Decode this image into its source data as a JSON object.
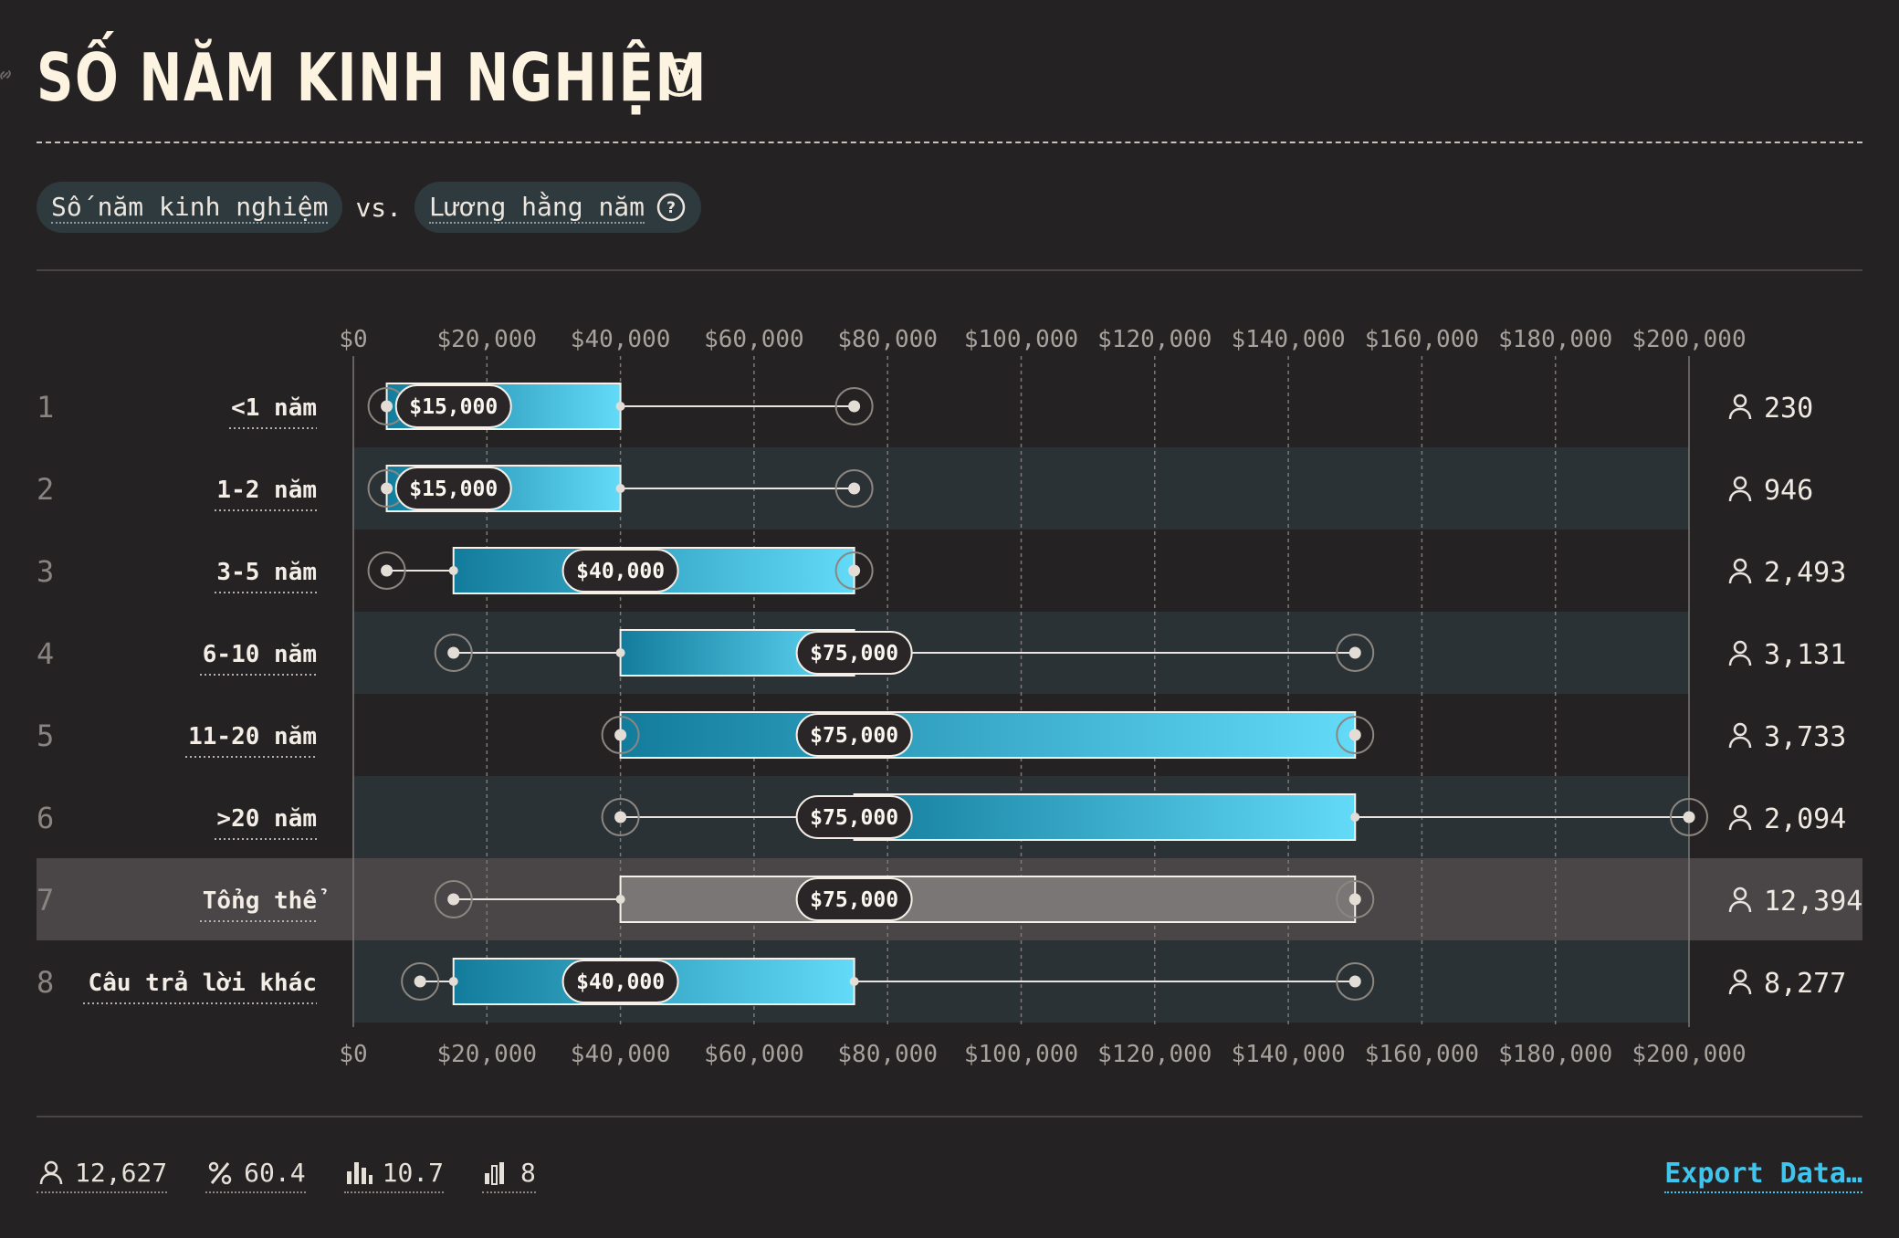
{
  "header": {
    "title": "Số năm kinh nghiệm"
  },
  "filters": {
    "primary_label": "Số năm kinh nghiệm",
    "separator": "vs.",
    "secondary_label": "Lương hằng năm"
  },
  "chart_data": {
    "type": "boxplot",
    "x_ticks": [
      "$0",
      "$20,000",
      "$40,000",
      "$60,000",
      "$80,000",
      "$100,000",
      "$120,000",
      "$140,000",
      "$160,000",
      "$180,000",
      "$200,000"
    ],
    "xlim": [
      0,
      200000
    ],
    "rows": [
      {
        "index": "1",
        "label": "<1 năm",
        "min": 5000,
        "q1": 5000,
        "median": 15000,
        "median_label": "$15,000",
        "q3": 40000,
        "max": 75000,
        "count": "230",
        "highlight": false
      },
      {
        "index": "2",
        "label": "1-2 năm",
        "min": 5000,
        "q1": 5000,
        "median": 15000,
        "median_label": "$15,000",
        "q3": 40000,
        "max": 75000,
        "count": "946",
        "highlight": false
      },
      {
        "index": "3",
        "label": "3-5 năm",
        "min": 5000,
        "q1": 15000,
        "median": 40000,
        "median_label": "$40,000",
        "q3": 75000,
        "max": 75000,
        "count": "2,493",
        "highlight": false
      },
      {
        "index": "4",
        "label": "6-10 năm",
        "min": 15000,
        "q1": 40000,
        "median": 75000,
        "median_label": "$75,000",
        "q3": 75000,
        "max": 150000,
        "count": "3,131",
        "highlight": false
      },
      {
        "index": "5",
        "label": "11-20 năm",
        "min": 40000,
        "q1": 40000,
        "median": 75000,
        "median_label": "$75,000",
        "q3": 150000,
        "max": 150000,
        "count": "3,733",
        "highlight": false
      },
      {
        "index": "6",
        "label": ">20 năm",
        "min": 40000,
        "q1": 75000,
        "median": 75000,
        "median_label": "$75,000",
        "q3": 150000,
        "max": 200000,
        "count": "2,094",
        "highlight": false
      },
      {
        "index": "7",
        "label": "Tổng thể",
        "min": 15000,
        "q1": 40000,
        "median": 75000,
        "median_label": "$75,000",
        "q3": 150000,
        "max": 150000,
        "count": "12,394",
        "highlight": true
      },
      {
        "index": "8",
        "label": "Câu trả lời khác",
        "min": 10000,
        "q1": 15000,
        "median": 40000,
        "median_label": "$40,000",
        "q3": 75000,
        "max": 150000,
        "count": "8,277",
        "highlight": false
      }
    ],
    "colors": {
      "box_start": "#137c9c",
      "box_end": "#62daf8",
      "overall_box": "#7a7676",
      "grid": "#7d7877",
      "band": "#2b3235"
    }
  },
  "footer": {
    "respondents": "12,627",
    "percent": "60.4",
    "score": "10.7",
    "groups": "8",
    "export_label": "Export Data…"
  }
}
